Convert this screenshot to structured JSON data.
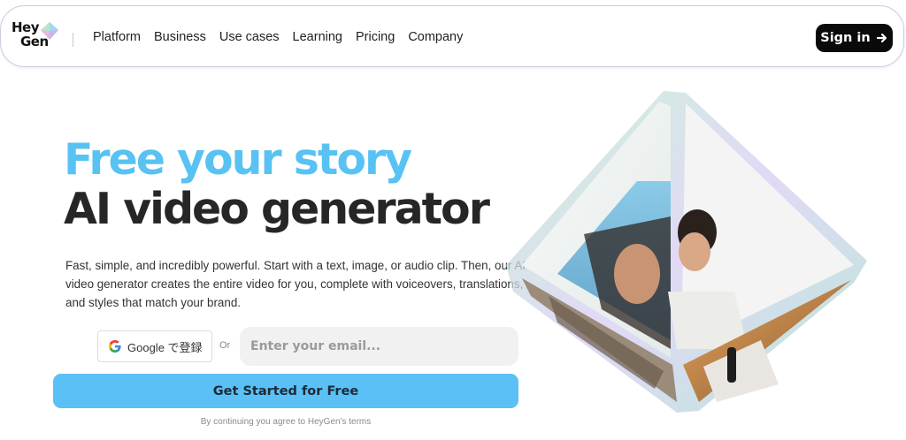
{
  "nav": {
    "logo": {
      "line1": "Hey",
      "line2": "Gen",
      "icon": "heygen-gem-icon"
    },
    "links": [
      {
        "label": "Platform"
      },
      {
        "label": "Business"
      },
      {
        "label": "Use cases"
      },
      {
        "label": "Learning"
      },
      {
        "label": "Pricing"
      },
      {
        "label": "Company"
      }
    ],
    "signin": {
      "label": "Sign in",
      "icon": "arrow-right-icon"
    }
  },
  "hero": {
    "headline_line1": "Free your story",
    "headline_line2": "AI video generator",
    "description": "Fast, simple, and incredibly powerful. Start with a text, image, or audio clip. Then, our AI video generator creates the entire video for you, complete with voiceovers, translations, and styles that match your brand."
  },
  "signup": {
    "google_label": "Google で登録",
    "google_icon": "google-g-icon",
    "or_label": "Or",
    "email_placeholder": "Enter your email...",
    "cta_label": "Get Started for Free",
    "terms": "By continuing you agree to HeyGen's terms"
  },
  "colors": {
    "accent_blue": "#58c2f3",
    "cta_blue": "#5ac0f6",
    "signin_bg": "#0a0a0a",
    "headline_dark": "#262626"
  }
}
